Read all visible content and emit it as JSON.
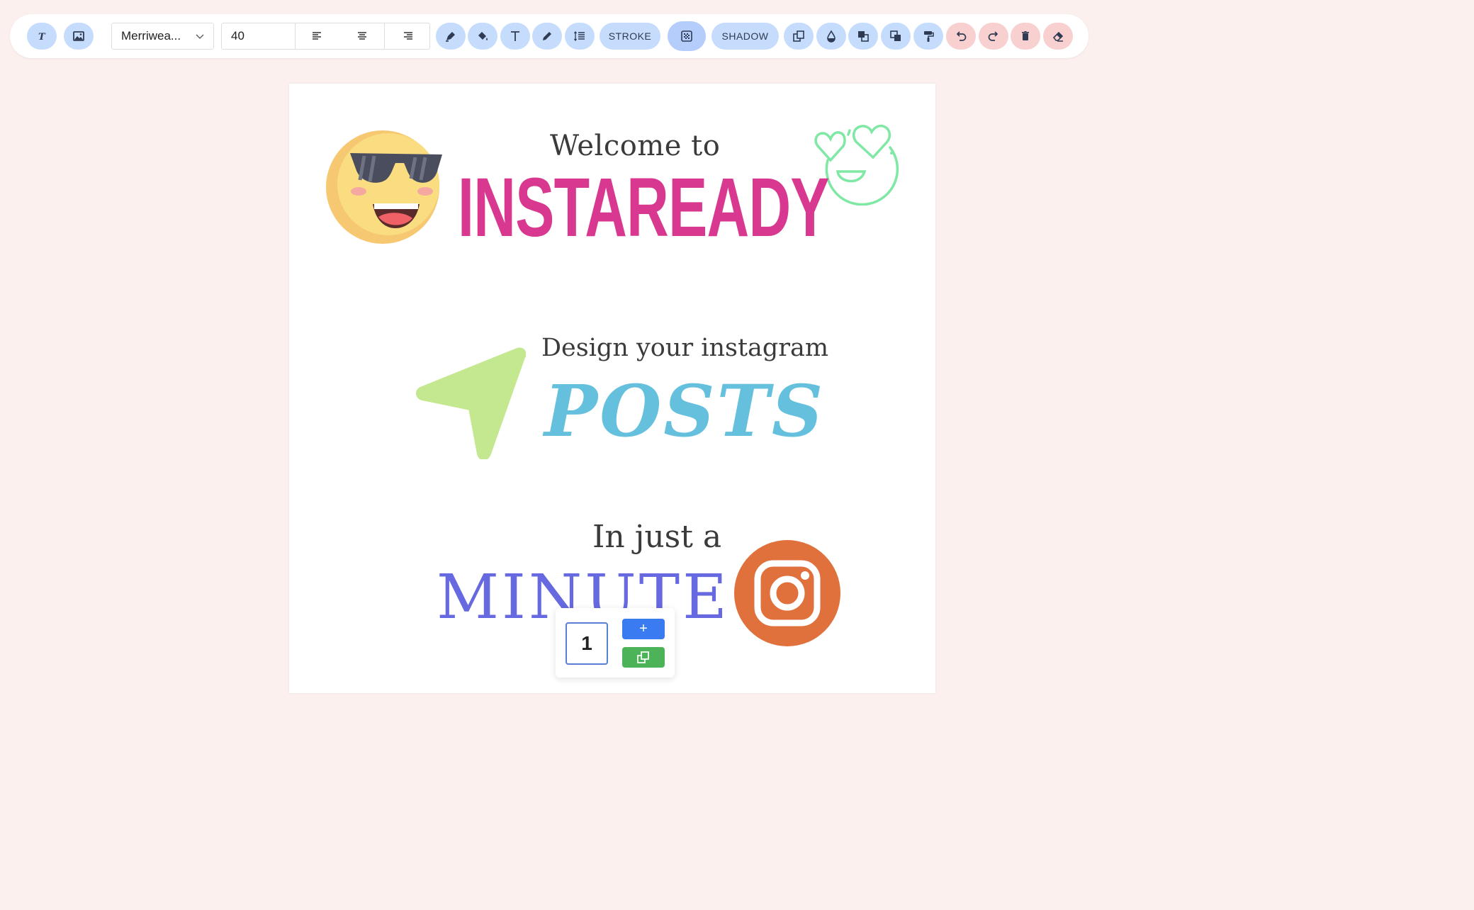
{
  "toolbar": {
    "font_select": {
      "value": "Merriwea...",
      "icon": "chevron-down-icon"
    },
    "font_size": {
      "value": "40"
    },
    "stroke_label": "STROKE",
    "shadow_label": "SHADOW",
    "icons": [
      "add-text-icon",
      "add-image-icon",
      "align-left-icon",
      "align-center-icon",
      "align-right-icon",
      "pen-icon",
      "fill-bucket-icon",
      "text-color-icon",
      "pencil-icon",
      "line-spacing-icon",
      "transparency-icon",
      "duplicate-icon",
      "opacity-icon",
      "bring-forward-icon",
      "send-backward-icon",
      "format-painter-icon",
      "undo-icon",
      "redo-icon",
      "delete-icon",
      "eraser-icon"
    ]
  },
  "canvas": {
    "welcome_text": "Welcome to",
    "brand_text": "INSTAREADY",
    "design_text": "Design your instagram",
    "posts_text": "POSTS",
    "injust_text": "In just a",
    "minute_text": "MINUTE",
    "colors": {
      "brand": "#d8388f",
      "posts": "#65c0de",
      "minute": "#6669e0",
      "instagram": "#e0703c",
      "arrow": "#c3e88f",
      "love_emoji": "#7fe8a4"
    }
  },
  "pager": {
    "page_number": "1",
    "add_label": "+"
  },
  "theme": {
    "background": "#fcf0ef",
    "button_blue": "#c6dcfd",
    "button_red": "#f8d0d0"
  }
}
